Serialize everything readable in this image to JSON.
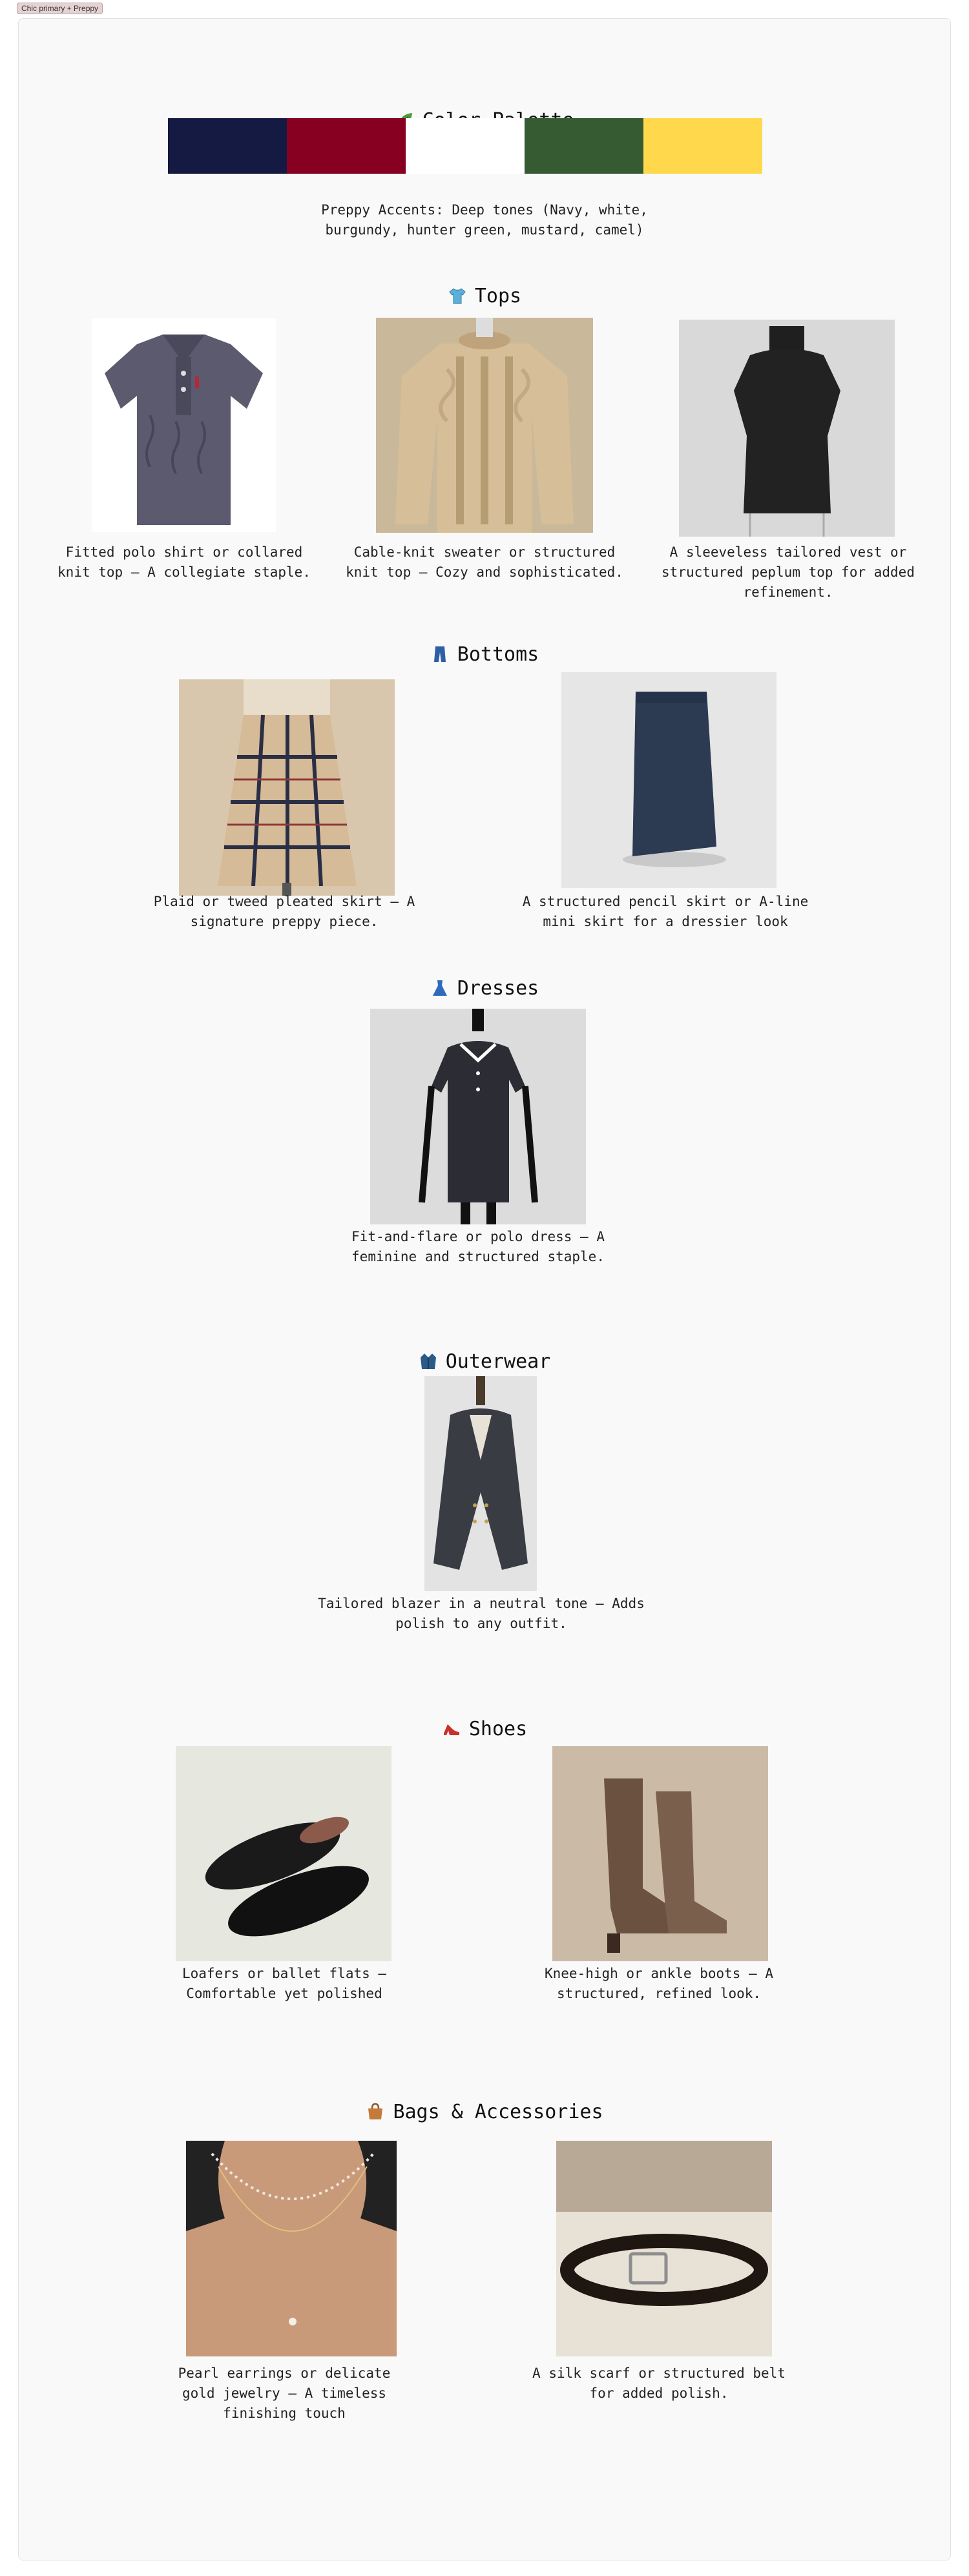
{
  "tab_label": "Chic primary + Preppy",
  "palette": {
    "title": "Color Palette",
    "icon": "leaf-icon",
    "colors": [
      "#141a42",
      "#870021",
      "#ffffff",
      "#365b33",
      "#ffd84c"
    ],
    "caption": "Preppy Accents: Deep tones (Navy, white, burgundy, hunter green, mustard, camel)"
  },
  "tops": {
    "title": "Tops",
    "icon": "tshirt-icon",
    "items": [
      {
        "caption": "Fitted polo shirt or collared knit top – A collegiate staple.",
        "image": "polo-shirt-image"
      },
      {
        "caption": "Cable-knit sweater or structured knit top – Cozy and sophisticated.",
        "image": "cable-knit-sweater-image"
      },
      {
        "caption": "A sleeveless tailored vest or structured peplum top for added refinement.",
        "image": "sleeveless-top-image"
      }
    ]
  },
  "bottoms": {
    "title": "Bottoms",
    "icon": "jeans-icon",
    "items": [
      {
        "caption": "Plaid or tweed pleated skirt – A signature preppy piece.",
        "image": "plaid-skirt-image"
      },
      {
        "caption": "A structured pencil skirt or A-line mini skirt for a dressier look",
        "image": "pencil-skirt-image"
      }
    ]
  },
  "dresses": {
    "title": "Dresses",
    "icon": "dress-icon",
    "items": [
      {
        "caption": "Fit-and-flare or polo dress – A feminine and structured staple.",
        "image": "polo-dress-image"
      }
    ]
  },
  "outerwear": {
    "title": "Outerwear",
    "icon": "coat-icon",
    "items": [
      {
        "caption": "Tailored blazer in a neutral tone – Adds polish to any outfit.",
        "image": "blazer-image"
      }
    ]
  },
  "shoes": {
    "title": "Shoes",
    "icon": "high-heel-icon",
    "items": [
      {
        "caption": "Loafers or ballet flats – Comfortable yet polished",
        "image": "loafers-image"
      },
      {
        "caption": "Knee-high or ankle boots – A structured, refined look.",
        "image": "boots-image"
      }
    ]
  },
  "bags": {
    "title": "Bags & Accessories",
    "icon": "handbag-icon",
    "items": [
      {
        "caption": "Pearl earrings or delicate gold jewelry – A timeless finishing touch",
        "image": "pearl-necklace-image"
      },
      {
        "caption": "A silk scarf or structured belt for added polish.",
        "image": "leather-belt-image"
      }
    ]
  }
}
